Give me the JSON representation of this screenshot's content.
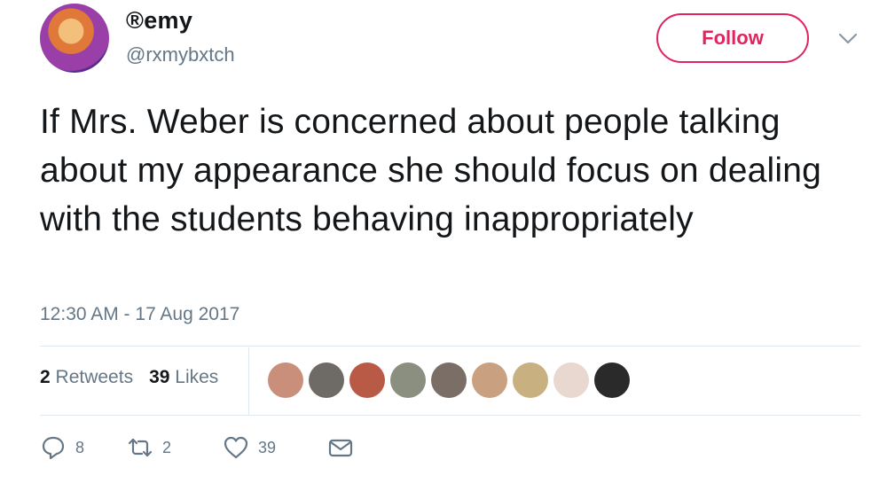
{
  "user": {
    "display_name": "®emy",
    "handle": "@rxmybxtch"
  },
  "follow_label": "Follow",
  "tweet": {
    "text": "If Mrs. Weber is concerned about people talking about my appearance she should focus on dealing with the students behaving inappropriately",
    "timestamp": "12:30 AM - 17 Aug 2017"
  },
  "stats": {
    "retweets_count": "2",
    "retweets_label": "Retweets",
    "likes_count": "39",
    "likes_label": "Likes"
  },
  "liker_avatar_colors": [
    "#c98f7a",
    "#6e6a66",
    "#b85a45",
    "#8a8f80",
    "#7a6e66",
    "#c9a080",
    "#c9b080",
    "#e8d8d0",
    "#2a2a2a"
  ],
  "actions": {
    "reply_count": "8",
    "retweet_count": "2",
    "like_count": "39"
  },
  "colors": {
    "accent": "#e0245e",
    "secondary_text": "#657786",
    "divider": "#e1e8ed"
  },
  "icons": [
    "chevron-down-icon",
    "reply-icon",
    "retweet-icon",
    "heart-icon",
    "envelope-icon"
  ]
}
